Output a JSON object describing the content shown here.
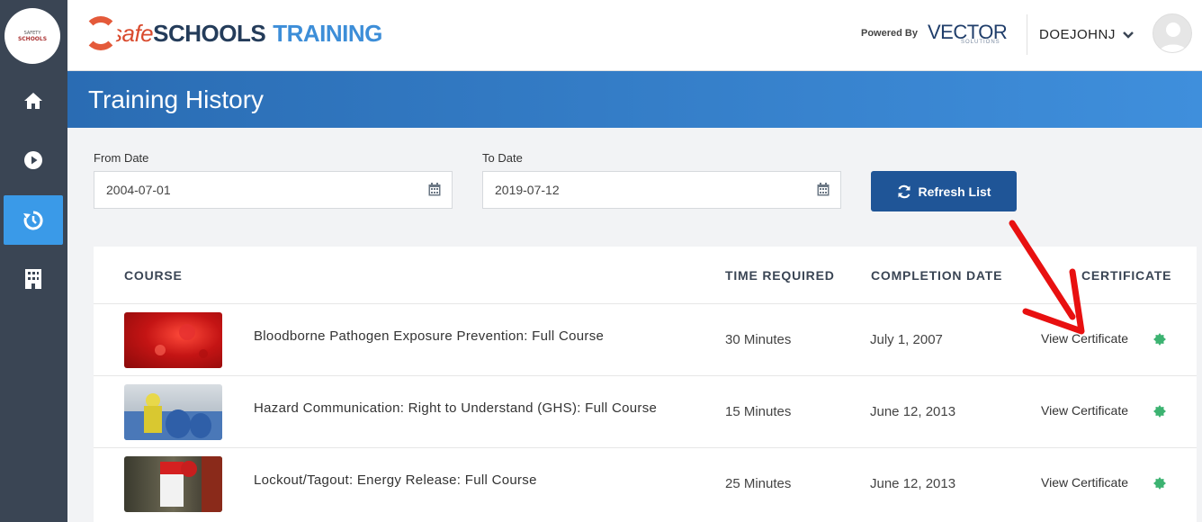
{
  "sidebar": {
    "logo_line1": "SAFETY",
    "logo_line2": "SCHOOLS",
    "items": [
      {
        "name": "home-icon"
      },
      {
        "name": "play-icon"
      },
      {
        "name": "history-icon",
        "active": true
      },
      {
        "name": "building-icon"
      }
    ]
  },
  "header": {
    "brand_safe": "safe",
    "brand_schools": "SCHOOLS",
    "brand_training": "TRAINING",
    "powered_by": "Powered By",
    "vector": "VECTOR",
    "vector_sub": "SOLUTIONS",
    "username": "DOEJOHNJ"
  },
  "page": {
    "title": "Training History"
  },
  "filters": {
    "from_label": "From Date",
    "from_value": "2004-07-01",
    "to_label": "To Date",
    "to_value": "2019-07-12",
    "refresh_label": "Refresh List"
  },
  "table": {
    "headers": {
      "course": "COURSE",
      "time": "TIME REQUIRED",
      "completion": "COMPLETION DATE",
      "certificate": "CERTIFICATE"
    },
    "rows": [
      {
        "course": "Bloodborne Pathogen Exposure Prevention: Full Course",
        "time": "30 Minutes",
        "date": "July 1, 2007",
        "cert": "View Certificate"
      },
      {
        "course": "Hazard Communication: Right to Understand (GHS): Full Course",
        "time": "15 Minutes",
        "date": "June 12, 2013",
        "cert": "View Certificate"
      },
      {
        "course": "Lockout/Tagout: Energy Release: Full Course",
        "time": "25 Minutes",
        "date": "June 12, 2013",
        "cert": "View Certificate"
      }
    ]
  },
  "colors": {
    "sidebar": "#3a4554",
    "active": "#3a9ae8",
    "button": "#1f5597",
    "status_dot": "#3cb371",
    "arrow": "#e81010"
  }
}
